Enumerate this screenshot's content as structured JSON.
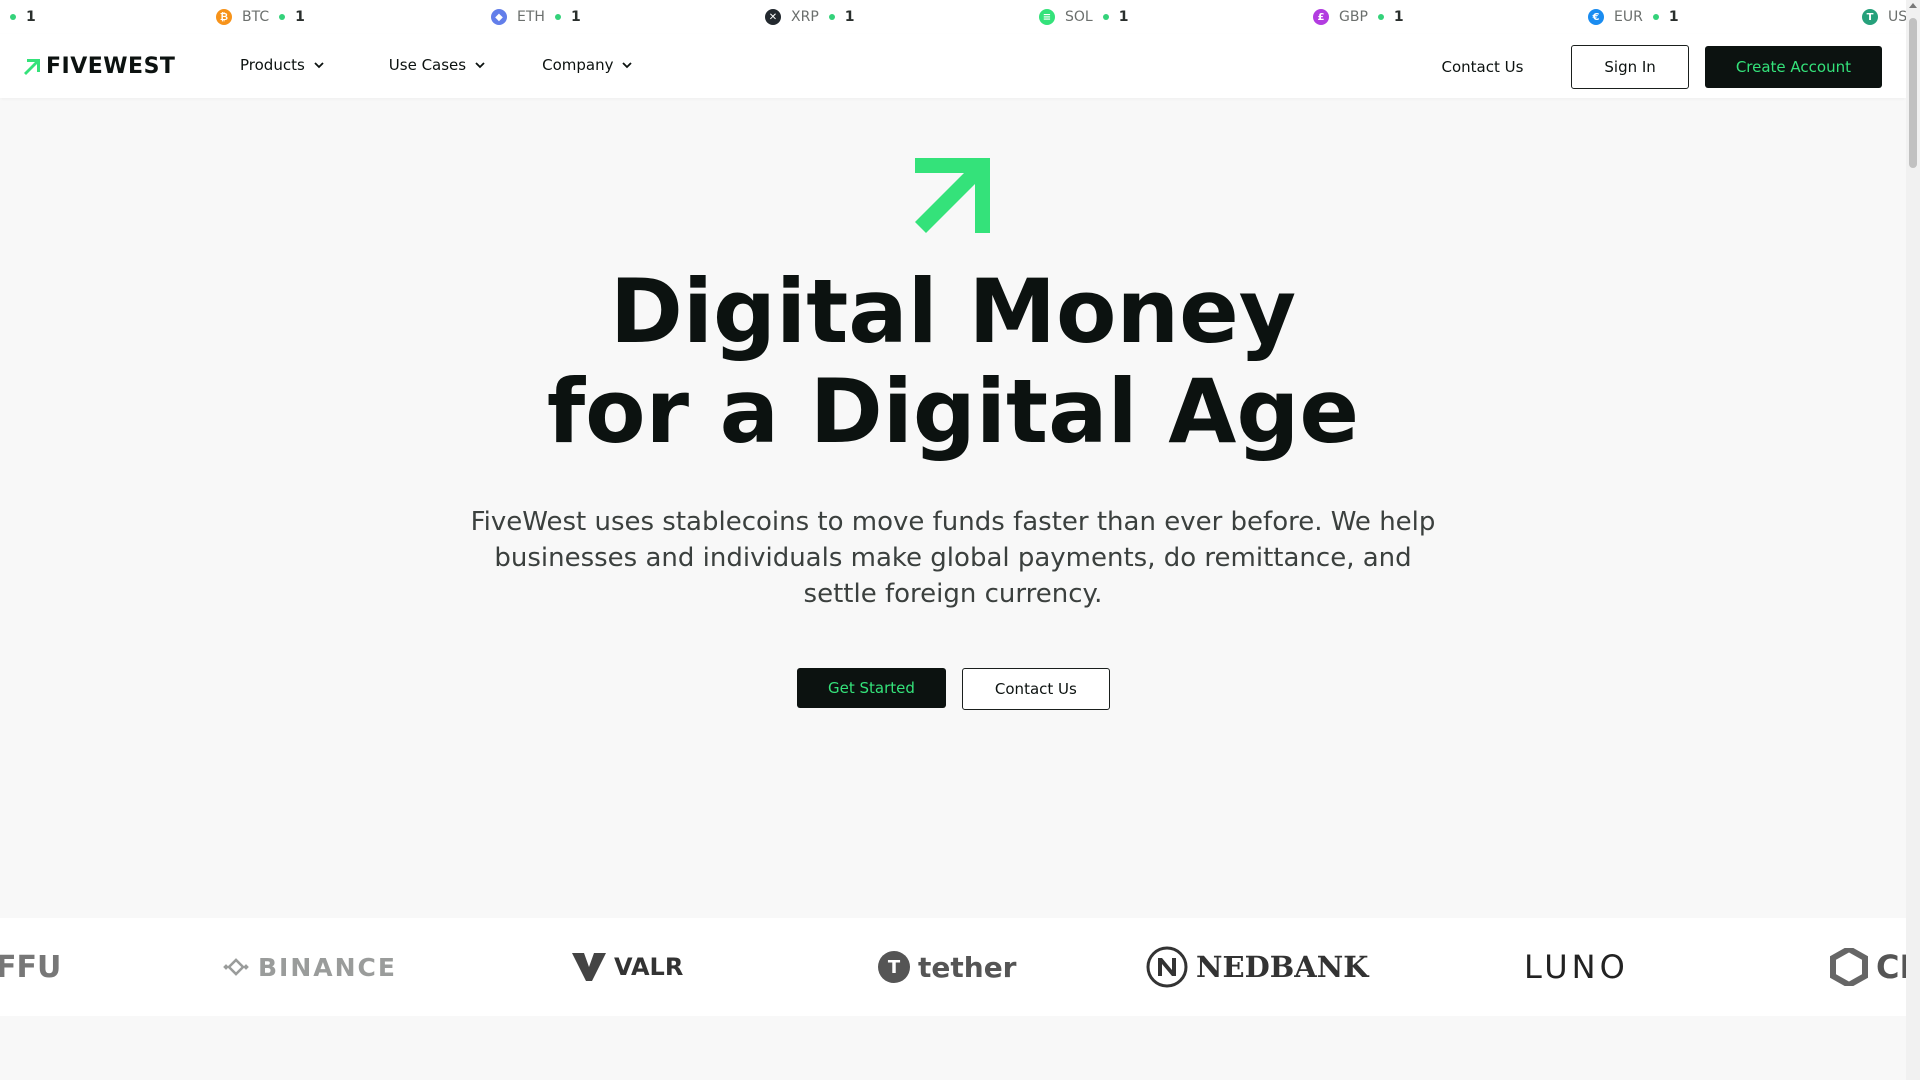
{
  "ticker": {
    "items": [
      {
        "symbol": "",
        "value": "1",
        "icon": "partial-coin-icon",
        "color": "#34d27a"
      },
      {
        "symbol": "BTC",
        "value": "1",
        "icon": "bitcoin-icon",
        "color": "#f7931a"
      },
      {
        "symbol": "ETH",
        "value": "1",
        "icon": "ethereum-icon",
        "color": "#627eea"
      },
      {
        "symbol": "XRP",
        "value": "1",
        "icon": "xrp-icon",
        "color": "#23292f"
      },
      {
        "symbol": "SOL",
        "value": "1",
        "icon": "solana-icon",
        "color": "#34e27a"
      },
      {
        "symbol": "GBP",
        "value": "1",
        "icon": "pound-icon",
        "color": "#b23ce0"
      },
      {
        "symbol": "EUR",
        "value": "1",
        "icon": "euro-icon",
        "color": "#1a8cf0"
      },
      {
        "symbol": "US",
        "value": "",
        "icon": "tether-icon",
        "color": "#26a17b"
      }
    ]
  },
  "nav": {
    "logo": "FIVEWEST",
    "products": "Products",
    "use_cases": "Use Cases",
    "company": "Company",
    "contact": "Contact Us",
    "sign_in": "Sign In",
    "create_account": "Create Account"
  },
  "hero": {
    "title_line1": "Digital Money",
    "title_line2": "for a Digital Age",
    "subtitle": "FiveWest uses stablecoins to move funds faster than ever before. We help businesses and individuals make global payments, do remittance, and settle foreign currency.",
    "get_started": "Get Started",
    "contact": "Contact Us"
  },
  "partners": {
    "items": [
      "FFU",
      "BINANCE",
      "VALR",
      "tether",
      "NEDBANK",
      "LUNO",
      "CI"
    ]
  },
  "colors": {
    "accent": "#34e27a",
    "dark": "#0c1210"
  }
}
